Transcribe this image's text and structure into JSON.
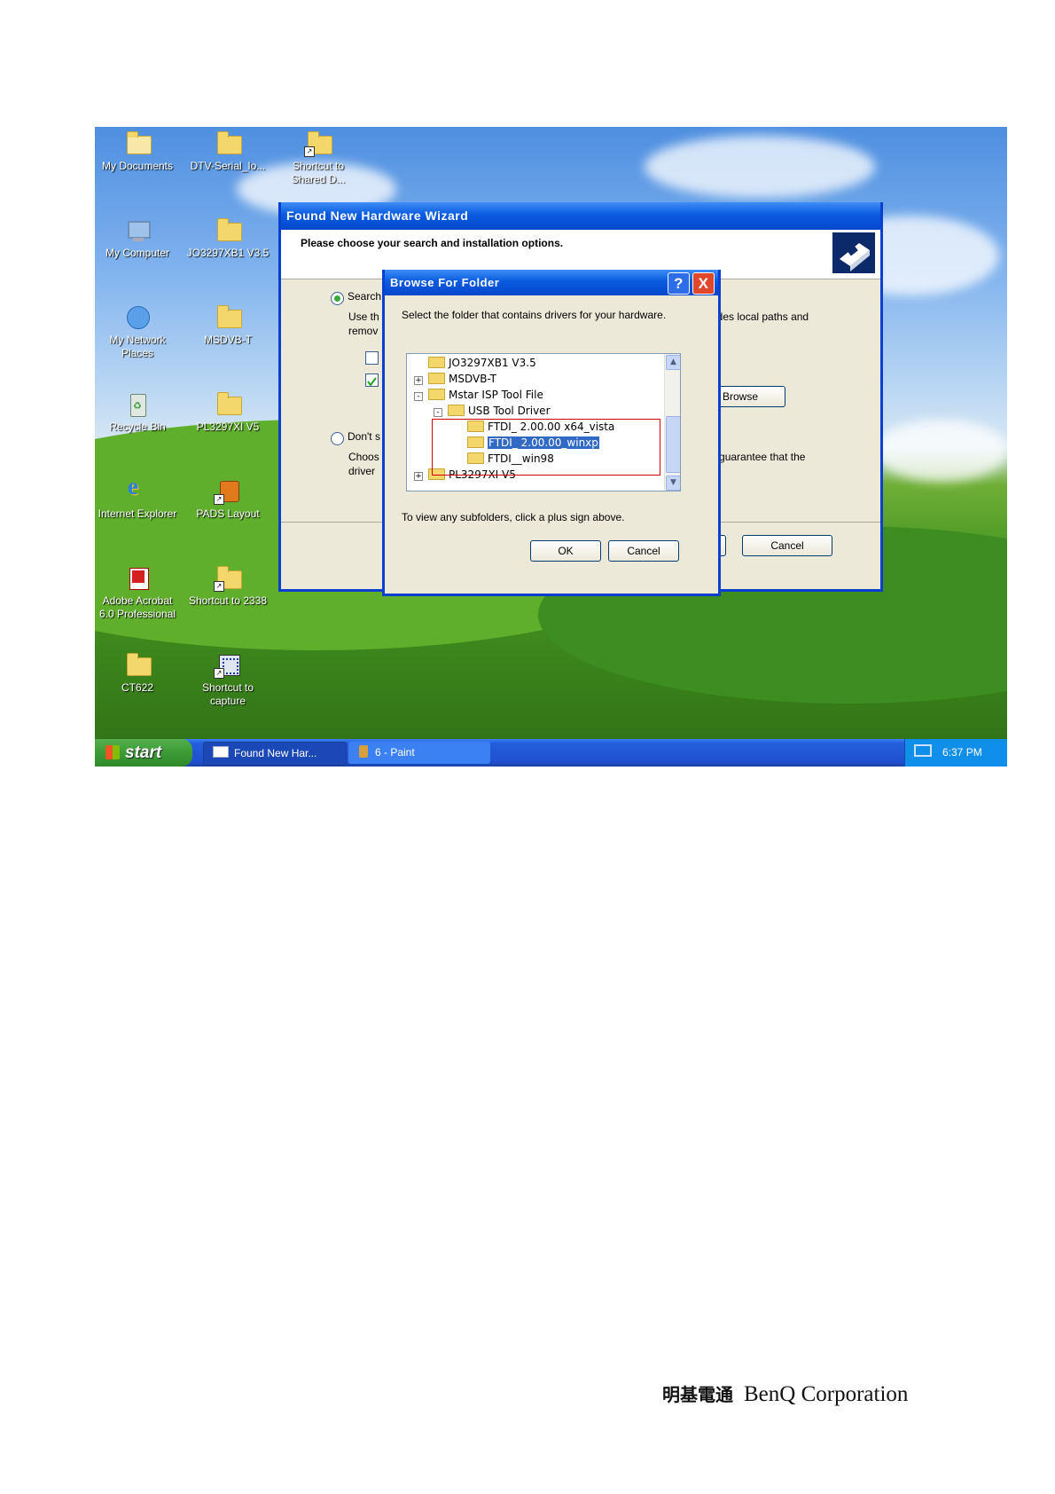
{
  "desktop": {
    "icons": [
      {
        "label": "My Documents",
        "icon": "my-documents-icon"
      },
      {
        "label": "DTV-Serial_Io...",
        "icon": "folder-icon"
      },
      {
        "label": "Shortcut to Shared D...",
        "icon": "folder-shortcut-icon"
      },
      {
        "label": "My Computer",
        "icon": "my-computer-icon"
      },
      {
        "label": "JO3297XB1 V3.5",
        "icon": "folder-icon"
      },
      {
        "label": "My Network Places",
        "icon": "network-places-icon"
      },
      {
        "label": "MSDVB-T",
        "icon": "folder-icon"
      },
      {
        "label": "Recycle Bin",
        "icon": "recycle-bin-icon"
      },
      {
        "label": "PL3297XI V5",
        "icon": "folder-icon"
      },
      {
        "label": "Internet Explorer",
        "icon": "internet-explorer-icon"
      },
      {
        "label": "PADS Layout",
        "icon": "pads-layout-icon"
      },
      {
        "label": "Adobe Acrobat 6.0 Professional",
        "icon": "adobe-acrobat-icon"
      },
      {
        "label": "Shortcut to 2338",
        "icon": "folder-shortcut-icon"
      },
      {
        "label": "CT622",
        "icon": "folder-icon"
      },
      {
        "label": "Shortcut to capture",
        "icon": "capture-shortcut-icon"
      }
    ]
  },
  "wizard": {
    "title": "Found New Hardware Wizard",
    "header": "Please choose your search and installation options.",
    "opt1_label": "Search",
    "opt1_desc_a": "Use th",
    "opt1_desc_b": "remov",
    "opt1_desc_right": "includes local paths and",
    "browse_label": "Browse",
    "opt2_label": "Don't s",
    "opt2_desc_a": "Choos",
    "opt2_desc_b": "driver",
    "opt2_desc_right": "not guarantee that the",
    "next_partial": ">",
    "cancel_label": "Cancel"
  },
  "browse_dialog": {
    "title": "Browse For Folder",
    "help_label": "?",
    "close_label": "X",
    "instruction": "Select the folder that contains drivers for your hardware.",
    "tree": [
      {
        "label": "JO3297XB1 V3.5",
        "expander": ""
      },
      {
        "label": "MSDVB-T",
        "expander": "+"
      },
      {
        "label": "Mstar ISP Tool File",
        "expander": "-"
      },
      {
        "label": "USB Tool Driver",
        "expander": "-"
      },
      {
        "label": "FTDI_ 2.00.00 x64_vista",
        "expander": ""
      },
      {
        "label": "FTDI_ 2.00.00_winxp",
        "expander": "",
        "selected": true
      },
      {
        "label": "FTDI__win98",
        "expander": ""
      },
      {
        "label": "PL3297XI V5",
        "expander": "+"
      }
    ],
    "hint": "To view any subfolders, click a plus sign above.",
    "ok_label": "OK",
    "cancel_label": "Cancel"
  },
  "taskbar": {
    "start_label": "start",
    "tasks": [
      {
        "label": "Found New Har...",
        "active": true
      },
      {
        "label": "6 - Paint",
        "active": false
      }
    ],
    "clock": "6:37 PM"
  },
  "footer": {
    "cjk": "明基電通",
    "company": "BenQ Corporation"
  },
  "colors": {
    "xp_blue": "#0a5be0",
    "selection": "#316ac5",
    "highlight_box": "#d00000"
  }
}
